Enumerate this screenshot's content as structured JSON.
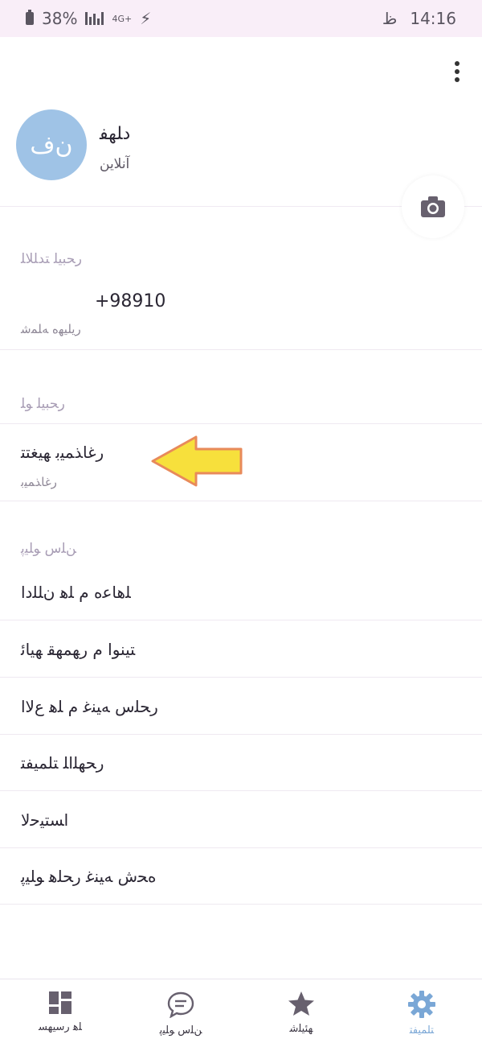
{
  "status_bar": {
    "battery": "38%",
    "network": "4G+",
    "time": "14:16",
    "time_suffix": "ظ"
  },
  "profile": {
    "avatar_initials": "ن‌ف",
    "name": "ﺩﻠﻬﻔ",
    "subtitle": "آنلاین"
  },
  "account_section": {
    "title": "ﺭﺤﺒﻴﻠ ﺘﺪﻠﻠﺎﻠ",
    "phone": "+98910",
    "phone_caption": "ﺭﻳﻠﻴﻬﻩ ﻪﻠﻤﺷ"
  },
  "app_section": {
    "title": "ﺭﺤﺒﻴﻠ ﻮﻠ",
    "language_row": "ﺭﻏﺎﺬﻤﻴﺑ ﻬﻴﻐﺘﺘ",
    "language_caption": "ﺭﻏﺎﺬﻤﻴﺑ"
  },
  "menu_section": {
    "title": "ﻦﻠﺱ ﻮﻠﻴﭘ",
    "items": [
      "ﻠﻫﺎﻋﻩ ﻡ ﻠﻫ ﻥﻠﻠﺩﺍ",
      "ﺘﻴﻨﻮﺍ ﻡ ﺭﻬﻤﻬﻘ ﻬﻴﺎﺋ",
      "ﺭﺤﻠﺱ ﻪﻴﻨﻏ ﻡ ﻠﻫ ﻉﻻﺍ",
      "ﺭﺤﻬﻠﺍﻠ ﺘﻠﻤﻴﻔﺘ",
      "ﺍﺴﺘﻴﺣﻻ",
      "ﻩﺤﺵ ﻪﻴﻨﻏ ﺭﺤﻠﻫ ﻮﻠﻴﭘ"
    ]
  },
  "bottom_nav": [
    {
      "label": "ﻠﻫ ﺭﺳﻴﻬﺴ",
      "icon": "dashboard-icon"
    },
    {
      "label": "ﻦﻠﺱ ﻮﻠﻴﭘ",
      "icon": "chat-icon"
    },
    {
      "label": "ﻬﺌﻴﻠﺷ",
      "icon": "star-icon"
    },
    {
      "label": "ﺘﻠﻤﻴﻔﺘ",
      "icon": "gear-icon",
      "active": true
    }
  ],
  "colors": {
    "accent": "#7aa7d6",
    "avatar_bg": "#9fc3e6",
    "arrow": "#f7e03c",
    "arrow_border": "#e88a5a"
  }
}
